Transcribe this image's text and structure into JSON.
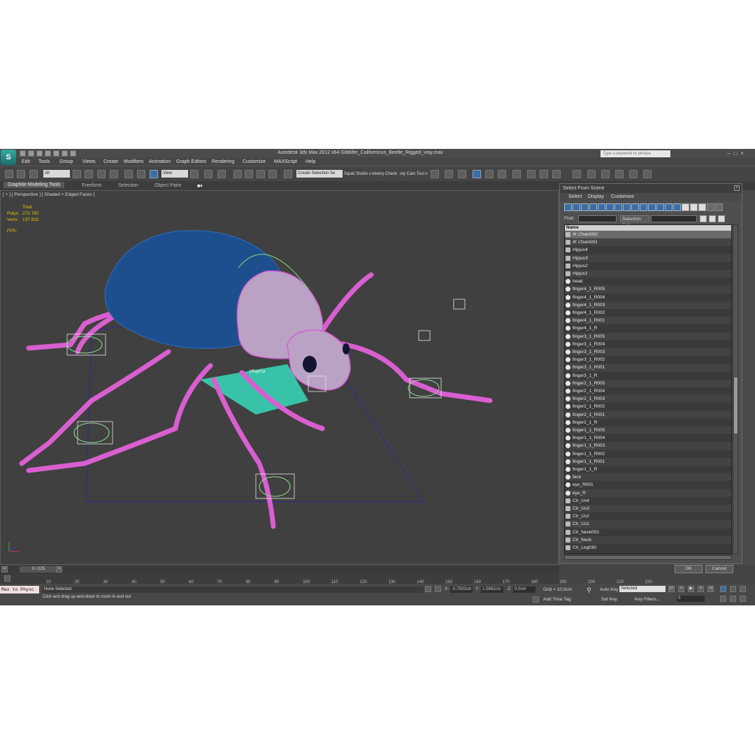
{
  "window": {
    "title": "Autodesk 3ds Max  2012 x64    Gibbifer_Californicus_Beetle_Rigged_vray.max",
    "app_icon": "3ds-max-logo",
    "search_placeholder": "Type a keyword or phrase"
  },
  "menus": [
    "Edit",
    "Tools",
    "Group",
    "Views",
    "Create",
    "Modifiers",
    "Animation",
    "Graph Editors",
    "Rendering",
    "Customize",
    "MAXScript",
    "Help"
  ],
  "toolbar": {
    "filter_value": "All",
    "refcoord_value": "View",
    "named_sel_value": "Create Selection Se",
    "plugin1": "Squid Studio v",
    "plugin2": "elivery Check",
    "plugin3": "uty Cam Tool v"
  },
  "ribbon_tabs": [
    "Graphite Modeling Tools",
    "Freeform",
    "Selection",
    "Object Paint"
  ],
  "viewport": {
    "label": "[ + ] [ Perspective ] [ Shaded + Edged Faces ]",
    "stats": {
      "total_label": "Total",
      "polys_label": "Polys:",
      "polys_value": "272 782",
      "verts_label": "Verts:",
      "verts_value": "137 822",
      "fps_label": "FPS:"
    },
    "helper_label": "VRayFur",
    "colors": {
      "wire": "#d95fd0",
      "shell": "#1d4f8f",
      "plane": "#38c3a8"
    }
  },
  "dialog": {
    "title": "Select From Scene",
    "menu": [
      "Select",
      "Display",
      "Customize"
    ],
    "find_label": "Find:",
    "selset_label": "Selection Set:",
    "column_header": "Name",
    "items": [
      "IK Chain002",
      "IK Chain001",
      "Hipjus4",
      "Hipjus3",
      "Hipjus2",
      "Hipjus1",
      "head",
      "finger4_1_R005",
      "finger4_1_R004",
      "finger4_1_R003",
      "finger4_1_R002",
      "finger4_1_R001",
      "finger4_1_R",
      "finger3_1_R005",
      "finger3_1_R004",
      "finger3_1_R003",
      "finger3_1_R002",
      "finger3_1_R001",
      "finger3_1_R",
      "finger2_1_R005",
      "finger2_1_R004",
      "finger2_1_R003",
      "finger2_1_R002",
      "finger2_1_R001",
      "finger2_1_R",
      "finger1_1_R005",
      "finger1_1_R004",
      "finger1_1_R003",
      "finger1_1_R002",
      "finger1_1_R001",
      "finger1_1_R",
      "face",
      "eye_R001",
      "eye_R",
      "Ctr_Us4",
      "Ctr_Us3",
      "Ctr_Us2",
      "Ctr_Us1",
      "Ctr_Neck002",
      "Ctr_Neck",
      "Ctr_Leg030"
    ],
    "ok": "OK",
    "cancel": "Cancel"
  },
  "timeline": {
    "slider": "0 / 225",
    "ticks": [
      "10",
      "20",
      "30",
      "40",
      "50",
      "60",
      "70",
      "80",
      "90",
      "100",
      "110",
      "120",
      "130",
      "140",
      "150",
      "160",
      "170",
      "180",
      "190",
      "200",
      "210",
      "220"
    ]
  },
  "status": {
    "maxscript": "Max to Physc",
    "selection": "None Selected",
    "prompt": "Click and drag up-and-down to zoom in and out",
    "x_label": "X:",
    "x_value": "-0,7502cm",
    "y_label": "Y:",
    "y_value": "1,5862cm",
    "z_label": "Z:",
    "z_value": "0,0cm",
    "grid": "Grid = 10,0cm",
    "add_time_tag": "Add Time Tag",
    "auto_key": "Auto Key",
    "auto_key_value": "Selected",
    "set_key": "Set Key",
    "key_filters": "Key Filters...",
    "frame": "0"
  }
}
